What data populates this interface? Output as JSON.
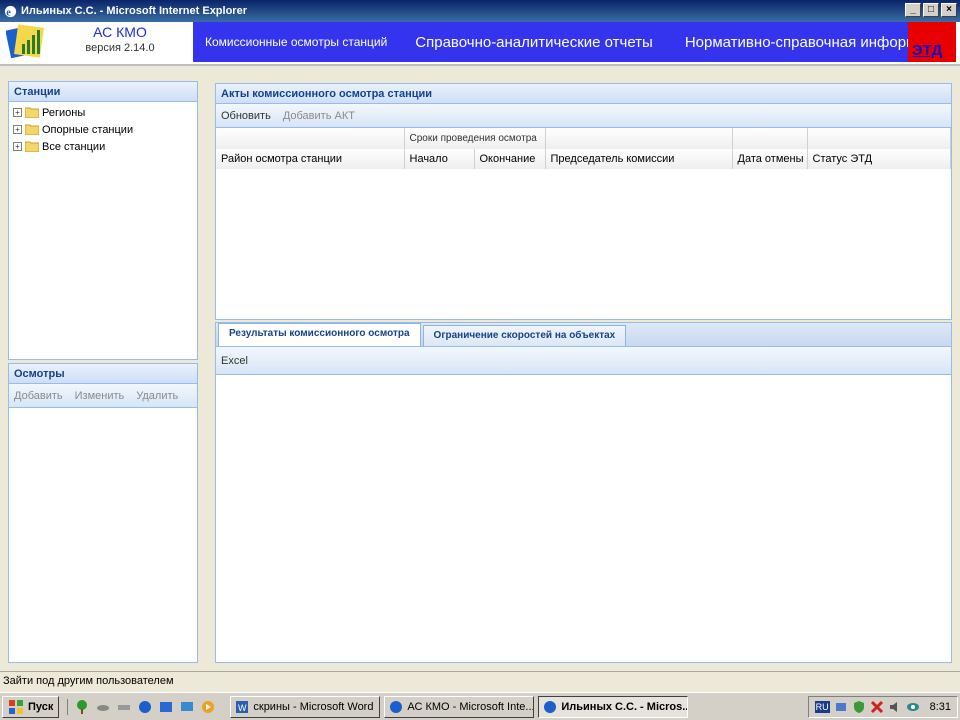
{
  "window": {
    "title": "Ильиных С.С. - Microsoft Internet Explorer",
    "buttons": [
      "_",
      "□",
      "×"
    ]
  },
  "header": {
    "app_title": "АС КМО",
    "version": "версия 2.14.0",
    "nav": [
      "Комиссионные осмотры станций",
      "Справочно-аналитические отчеты",
      "Нормативно-справочная информа"
    ],
    "etd_label": "ЭТД"
  },
  "stations_panel": {
    "title": "Станции",
    "items": [
      "Регионы",
      "Опорные станции",
      "Все станции"
    ]
  },
  "inspections_panel": {
    "title": "Осмотры",
    "toolbar": [
      "Добавить",
      "Изменить",
      "Удалить"
    ]
  },
  "acts_panel": {
    "title": "Акты комиссионного осмотра станции",
    "toolbar": {
      "refresh": "Обновить",
      "add": "Добавить АКТ"
    },
    "group_header": "Сроки проведения осмотра",
    "columns": [
      "Район осмотра станции",
      "Начало",
      "Окончание",
      "Председатель комиссии",
      "Дата отмены",
      "Статус ЭТД"
    ]
  },
  "results_panel": {
    "tabs": [
      "Результаты комиссионного осмотра",
      "Ограничение скоростей на объектах"
    ],
    "toolbar": {
      "excel": "Excel"
    }
  },
  "statusbar": {
    "text": "Зайти под другим пользователем"
  },
  "taskbar": {
    "start": "Пуск",
    "tasks": [
      "скрины - Microsoft Word",
      "АС КМО - Microsoft Inte...",
      "Ильиных С.С. - Micros..."
    ],
    "lang": "RU",
    "clock": "8:31"
  },
  "colors": {
    "nav_bg": "#3434ee",
    "etd_bg": "#e80000",
    "panel_title": "#15428b"
  }
}
